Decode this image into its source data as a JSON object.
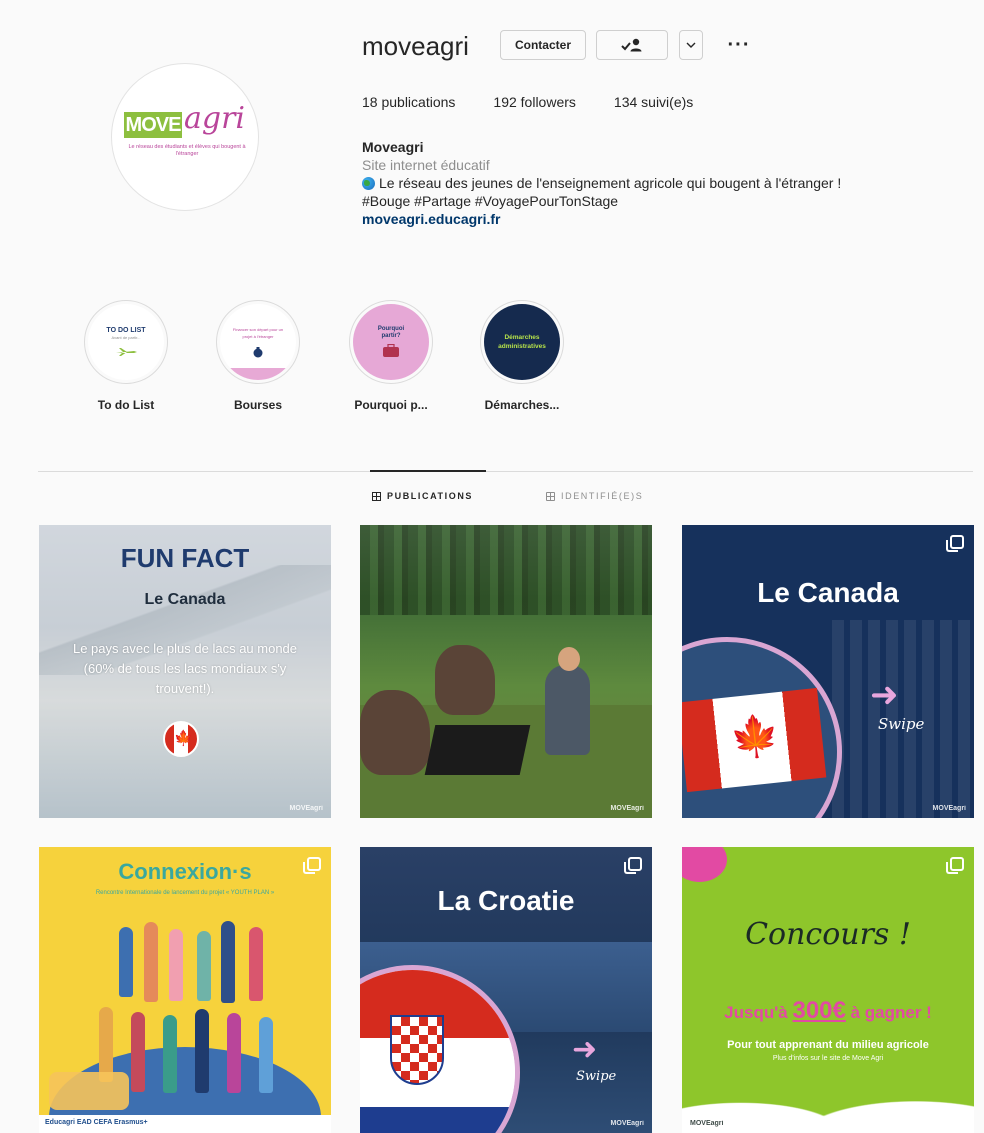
{
  "profile": {
    "username": "moveagri",
    "buttons": {
      "contact": "Contacter",
      "follow_icon": "person-check-icon",
      "suggest_icon": "chevron-down-icon",
      "more": "···"
    },
    "stats": {
      "publications": "18 publications",
      "followers": "192 followers",
      "following": "134 suivi(e)s"
    },
    "bio": {
      "full_name": "Moveagri",
      "category": "Site internet éducatif",
      "description": "Le réseau des jeunes de l'enseignement agricole qui bougent à l'étranger !",
      "hashtags": "#Bouge #Partage #VoyagePourTonStage",
      "link": "moveagri.educagri.fr"
    },
    "avatar_logo": {
      "move": "MOVE",
      "agri": "agri",
      "tagline": "Le réseau des étudiants et élèves qui bougent à l'étranger"
    }
  },
  "highlights": [
    {
      "label": "To do List",
      "cover_text": "TO DO LIST",
      "cover_sub": "Avant de partir..."
    },
    {
      "label": "Bourses",
      "cover_text": "Financer son départ pour un projet à l'étranger"
    },
    {
      "label": "Pourquoi p...",
      "cover_text": "Pourquoi partir?"
    },
    {
      "label": "Démarches...",
      "cover_text": "Démarches administratives"
    }
  ],
  "tabs": {
    "publications": "PUBLICATIONS",
    "tagged": "IDENTIFIÉ(E)S"
  },
  "posts": [
    {
      "title": "FUN FACT",
      "subtitle": "Le Canada",
      "text": "Le pays avec le plus de lacs au monde (60% de tous les lacs mondiaux s'y trouvent!).",
      "watermark": "MOVEagri"
    },
    {
      "watermark": "MOVEagri"
    },
    {
      "title": "Le Canada",
      "swipe": "Swipe",
      "arrow": "➜",
      "watermark": "MOVEagri"
    },
    {
      "title": "Connexion·s",
      "subtitle": "Rencontre Internationale de lancement du projet « YOUTH PLAN »",
      "logos": "Educagri   EAD   CEFA   Erasmus+"
    },
    {
      "title": "La Croatie",
      "swipe": "Swipe",
      "arrow": "➜",
      "watermark": "MOVEagri"
    },
    {
      "title": "Concours !",
      "prize_prefix": "Jusqu'à ",
      "prize_amount": "300€",
      "prize_suffix": " à gagner !",
      "line1": "Pour tout apprenant du milieu agricole",
      "line2": "Plus d'infos sur le site de Move Agri",
      "watermark": "MOVEagri"
    }
  ],
  "colors": {
    "brand_green": "#8dbf3f",
    "brand_pink": "#b9459a",
    "link_blue": "#00376b"
  }
}
